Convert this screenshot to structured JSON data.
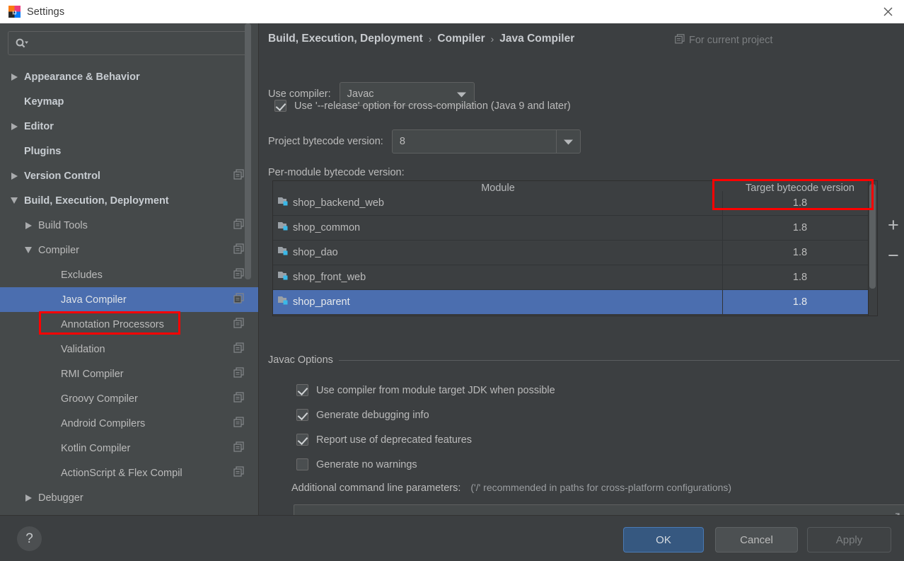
{
  "window": {
    "title": "Settings",
    "app_icon": "intellij-idea-icon",
    "close_icon": "close-icon"
  },
  "sidebar": {
    "search": {
      "placeholder": "",
      "value": "",
      "icon": "search-icon",
      "dropdown_icon": "chevron-down-icon"
    },
    "items": [
      {
        "label": "Appearance & Behavior",
        "indent": 0,
        "arrow": "collapsed",
        "bold": true,
        "copy_icon": false,
        "selected": false
      },
      {
        "label": "Keymap",
        "indent": 0,
        "arrow": "none",
        "bold": true,
        "copy_icon": false,
        "selected": false
      },
      {
        "label": "Editor",
        "indent": 0,
        "arrow": "collapsed",
        "bold": true,
        "copy_icon": false,
        "selected": false
      },
      {
        "label": "Plugins",
        "indent": 0,
        "arrow": "none",
        "bold": true,
        "copy_icon": false,
        "selected": false
      },
      {
        "label": "Version Control",
        "indent": 0,
        "arrow": "collapsed",
        "bold": true,
        "copy_icon": true,
        "selected": false
      },
      {
        "label": "Build, Execution, Deployment",
        "indent": 0,
        "arrow": "expanded",
        "bold": true,
        "copy_icon": false,
        "selected": false
      },
      {
        "label": "Build Tools",
        "indent": 1,
        "arrow": "collapsed",
        "bold": false,
        "copy_icon": true,
        "selected": false
      },
      {
        "label": "Compiler",
        "indent": 1,
        "arrow": "expanded",
        "bold": false,
        "copy_icon": true,
        "selected": false
      },
      {
        "label": "Excludes",
        "indent": 2,
        "arrow": "none",
        "bold": false,
        "copy_icon": true,
        "selected": false
      },
      {
        "label": "Java Compiler",
        "indent": 2,
        "arrow": "none",
        "bold": false,
        "copy_icon": true,
        "selected": true
      },
      {
        "label": "Annotation Processors",
        "indent": 2,
        "arrow": "none",
        "bold": false,
        "copy_icon": true,
        "selected": false
      },
      {
        "label": "Validation",
        "indent": 2,
        "arrow": "none",
        "bold": false,
        "copy_icon": true,
        "selected": false
      },
      {
        "label": "RMI Compiler",
        "indent": 2,
        "arrow": "none",
        "bold": false,
        "copy_icon": true,
        "selected": false
      },
      {
        "label": "Groovy Compiler",
        "indent": 2,
        "arrow": "none",
        "bold": false,
        "copy_icon": true,
        "selected": false
      },
      {
        "label": "Android Compilers",
        "indent": 2,
        "arrow": "none",
        "bold": false,
        "copy_icon": true,
        "selected": false
      },
      {
        "label": "Kotlin Compiler",
        "indent": 2,
        "arrow": "none",
        "bold": false,
        "copy_icon": true,
        "selected": false
      },
      {
        "label": "ActionScript & Flex Compil",
        "indent": 2,
        "arrow": "none",
        "bold": false,
        "copy_icon": true,
        "selected": false
      },
      {
        "label": "Debugger",
        "indent": 1,
        "arrow": "collapsed",
        "bold": false,
        "copy_icon": false,
        "selected": false
      }
    ]
  },
  "main": {
    "breadcrumb": {
      "parts": [
        "Build, Execution, Deployment",
        "Compiler",
        "Java Compiler"
      ],
      "separator": "›"
    },
    "scope": {
      "icon": "copy-icon",
      "label": "For current project"
    },
    "use_compiler": {
      "label": "Use compiler:",
      "value": "Javac",
      "arrow_icon": "chevron-down-icon"
    },
    "release_option": {
      "label": "Use '--release' option for cross-compilation (Java 9 and later)",
      "checked": true
    },
    "project_bytecode": {
      "label": "Project bytecode version:",
      "value": "8",
      "arrow_icon": "chevron-down-icon"
    },
    "per_module_label": "Per-module bytecode version:",
    "table": {
      "columns": [
        "Module",
        "Target bytecode version"
      ],
      "rows": [
        {
          "module": "shop_backend_web",
          "target": "1.8",
          "icon": "module-icon",
          "selected": false
        },
        {
          "module": "shop_common",
          "target": "1.8",
          "icon": "module-icon",
          "selected": false
        },
        {
          "module": "shop_dao",
          "target": "1.8",
          "icon": "module-icon",
          "selected": false
        },
        {
          "module": "shop_front_web",
          "target": "1.8",
          "icon": "module-icon",
          "selected": false
        },
        {
          "module": "shop_parent",
          "target": "1.8",
          "icon": "module-icon",
          "selected": true
        }
      ],
      "add_button": "+",
      "remove_button": "−"
    },
    "javac_options": {
      "title": "Javac Options",
      "checkboxes": [
        {
          "label": "Use compiler from module target JDK when possible",
          "checked": true
        },
        {
          "label": "Generate debugging info",
          "checked": true
        },
        {
          "label": "Report use of deprecated features",
          "checked": true
        },
        {
          "label": "Generate no warnings",
          "checked": false
        }
      ],
      "additional_params_label": "Additional command line parameters:",
      "additional_params_hint": "('/' recommended in paths for cross-platform configurations)",
      "additional_params_value": "",
      "expand_icon": "expand-icon"
    }
  },
  "footer": {
    "help_label": "?",
    "ok_label": "OK",
    "cancel_label": "Cancel",
    "apply_label": "Apply"
  },
  "annotations": {
    "highlight_color": "#fe0000",
    "boxes": [
      "java-compiler-sidebar-item",
      "target-bytecode-version-column-header"
    ]
  }
}
